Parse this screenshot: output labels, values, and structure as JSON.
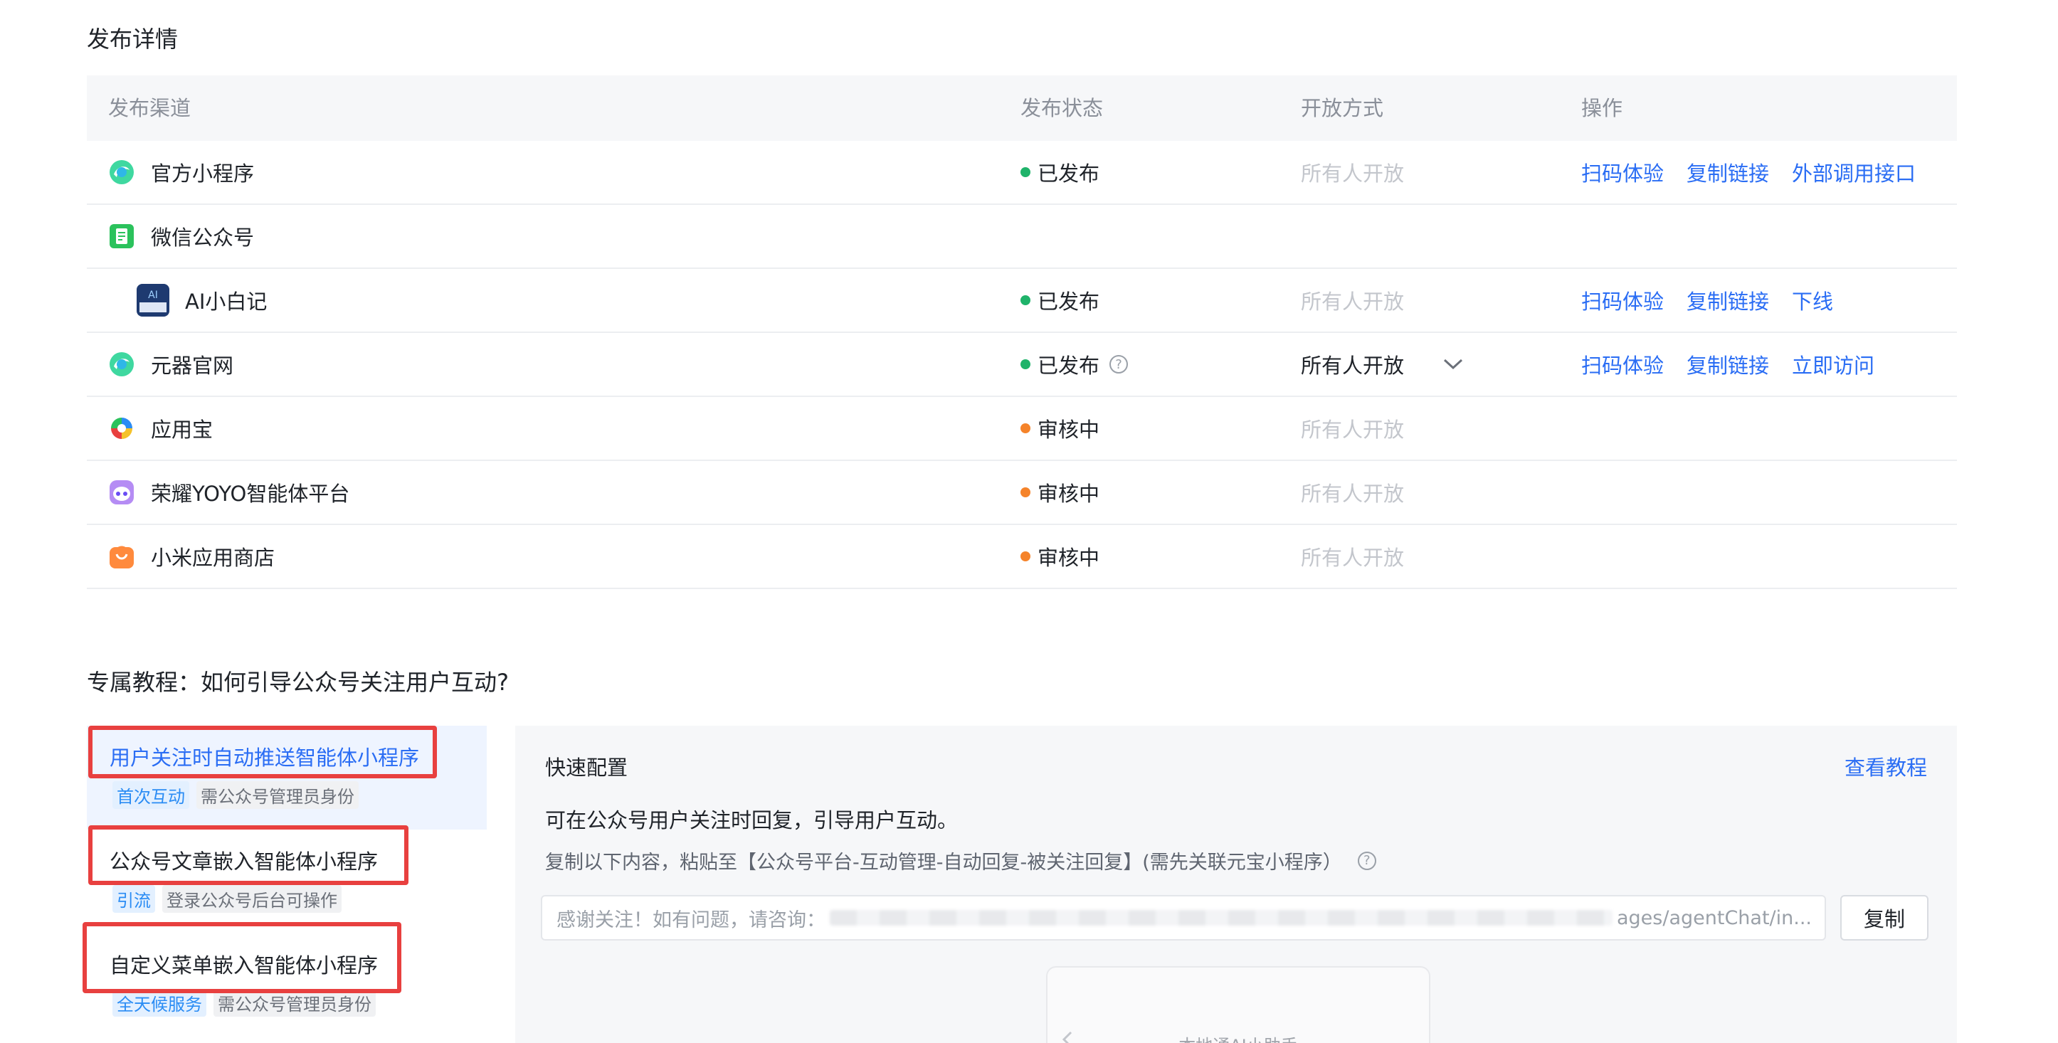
{
  "publish": {
    "title": "发布详情",
    "headers": [
      "发布渠道",
      "发布状态",
      "开放方式",
      "操作"
    ],
    "rows": [
      {
        "name": "官方小程序",
        "status": "已发布",
        "status_color": "#1fb36a",
        "open": "所有人开放",
        "open_muted": true,
        "ops": [
          "扫码体验",
          "复制链接",
          "外部调用接口"
        ],
        "icon": "yuanbao-icon"
      },
      {
        "name": "微信公众号",
        "status": "",
        "open": "",
        "ops": [],
        "icon": "wechat-official-icon"
      },
      {
        "name": "AI小白记",
        "status": "已发布",
        "status_color": "#1fb36a",
        "open": "所有人开放",
        "open_muted": true,
        "ops": [
          "扫码体验",
          "复制链接",
          "下线"
        ],
        "icon": "account-avatar-icon",
        "sub": true
      },
      {
        "name": "元器官网",
        "status": "已发布",
        "status_color": "#1fb36a",
        "open": "所有人开放",
        "open_muted": false,
        "ops": [
          "扫码体验",
          "复制链接",
          "立即访问"
        ],
        "icon": "yuanbao-icon",
        "help": true,
        "dropdown": true
      },
      {
        "name": "应用宝",
        "status": "审核中",
        "status_color": "#f5832a",
        "open": "所有人开放",
        "open_muted": true,
        "ops": [],
        "icon": "yingyongbao-icon"
      },
      {
        "name": "荣耀YOYO智能体平台",
        "status": "审核中",
        "status_color": "#f5832a",
        "open": "所有人开放",
        "open_muted": true,
        "ops": [],
        "icon": "yoyo-icon"
      },
      {
        "name": "小米应用商店",
        "status": "审核中",
        "status_color": "#f5832a",
        "open": "所有人开放",
        "open_muted": true,
        "ops": [],
        "icon": "xiaomi-store-icon"
      }
    ]
  },
  "tutorial": {
    "title": "专属教程：如何引导公众号关注用户互动?",
    "items": [
      {
        "label": "用户关注时自动推送智能体小程序",
        "tags": [
          "首次互动",
          "需公众号管理员身份"
        ],
        "active": true
      },
      {
        "label": "公众号文章嵌入智能体小程序",
        "tags": [
          "引流",
          "登录公众号后台可操作"
        ],
        "active": false
      },
      {
        "label": "自定义菜单嵌入智能体小程序",
        "tags": [
          "全天候服务",
          "需公众号管理员身份"
        ],
        "active": false
      }
    ],
    "panel": {
      "title": "快速配置",
      "view_tutorial": "查看教程",
      "desc1": "可在公众号用户关注时回复，引导用户互动。",
      "desc2": "复制以下内容，粘贴至【公众号平台-互动管理-自动回复-被关注回复】(需先关联元宝小程序）",
      "copy_text_prefix": "感谢关注！如有问题，请咨询：",
      "copy_text_suffix": "ages/agentChat/in...",
      "copy_button": "复制",
      "phone_title": "本地通AI小助手"
    }
  }
}
